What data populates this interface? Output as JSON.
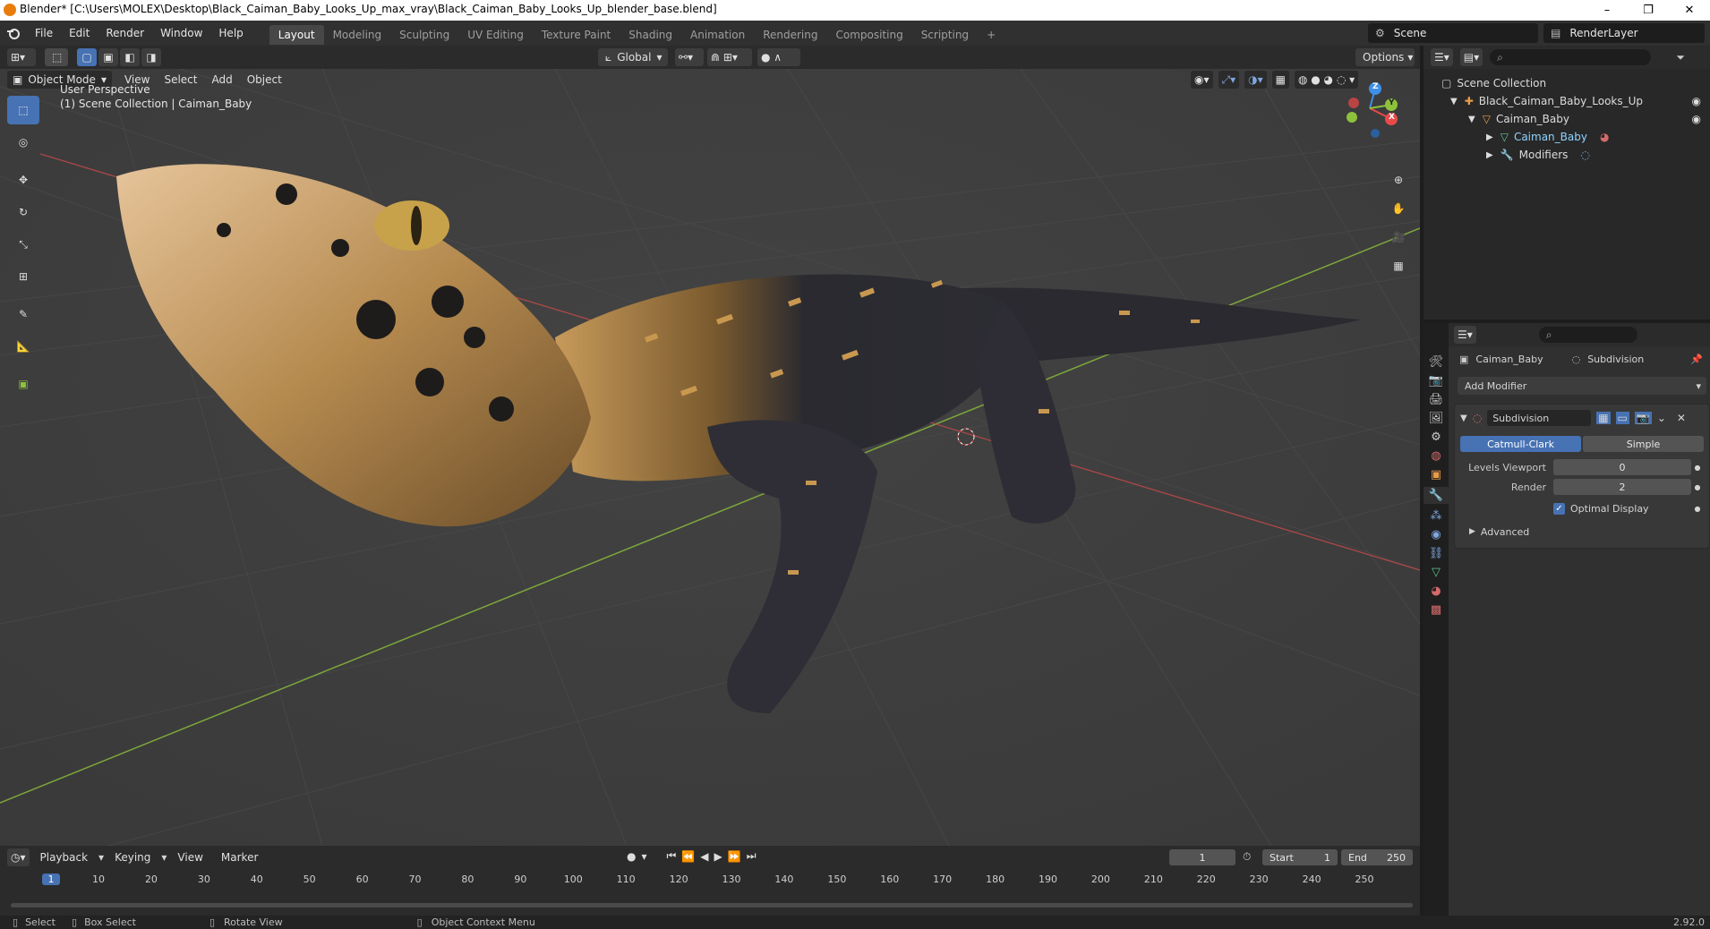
{
  "window": {
    "title": "Blender* [C:\\Users\\MOLEX\\Desktop\\Black_Caiman_Baby_Looks_Up_max_vray\\Black_Caiman_Baby_Looks_Up_blender_base.blend]",
    "minimize": "–",
    "maximize": "❐",
    "close": "✕"
  },
  "menu": {
    "items": [
      "File",
      "Edit",
      "Render",
      "Window",
      "Help"
    ],
    "workspaces": [
      "Layout",
      "Modeling",
      "Sculpting",
      "UV Editing",
      "Texture Paint",
      "Shading",
      "Animation",
      "Rendering",
      "Compositing",
      "Scripting"
    ],
    "add_workspace": "+",
    "scene": "Scene",
    "render_layer": "RenderLayer"
  },
  "viewport_header": {
    "transform_orientation": "Global",
    "options": "Options",
    "mode": "Object Mode",
    "menus": [
      "View",
      "Select",
      "Add",
      "Object"
    ]
  },
  "viewport": {
    "perspective": "User Perspective",
    "collection_info": "(1) Scene Collection | Caiman_Baby",
    "gizmo": {
      "x": "X",
      "y": "Y",
      "z": "Z"
    }
  },
  "outliner": {
    "root": "Scene Collection",
    "items": [
      {
        "label": "Black_Caiman_Baby_Looks_Up",
        "level": 1
      },
      {
        "label": "Caiman_Baby",
        "level": 2
      },
      {
        "label": "Caiman_Baby",
        "level": 3
      },
      {
        "label": "Modifiers",
        "level": 3
      }
    ]
  },
  "properties": {
    "object_name": "Caiman_Baby",
    "modifier_label": "Subdivision",
    "add_modifier": "Add Modifier",
    "modifier": {
      "name": "Subdivision",
      "type_options": [
        "Catmull-Clark",
        "Simple"
      ],
      "levels_viewport_label": "Levels Viewport",
      "levels_viewport": "0",
      "render_label": "Render",
      "render": "2",
      "optimal_display": "Optimal Display",
      "advanced": "Advanced"
    }
  },
  "timeline": {
    "menus": [
      "Playback",
      "Keying",
      "View",
      "Marker"
    ],
    "current_frame": "1",
    "start_label": "Start",
    "start": "1",
    "end_label": "End",
    "end": "250",
    "ticks": [
      "1",
      "10",
      "20",
      "30",
      "40",
      "50",
      "60",
      "70",
      "80",
      "90",
      "100",
      "110",
      "120",
      "130",
      "140",
      "150",
      "160",
      "170",
      "180",
      "190",
      "200",
      "210",
      "220",
      "230",
      "240",
      "250"
    ]
  },
  "statusbar": {
    "select": "Select",
    "box_select": "Box Select",
    "rotate_view": "Rotate View",
    "context_menu": "Object Context Menu",
    "version": "2.92.0"
  },
  "colors": {
    "accent": "#4772b3",
    "x_axis": "#e84a4a",
    "y_axis": "#8dc23b",
    "z_axis": "#3d8fe8"
  }
}
